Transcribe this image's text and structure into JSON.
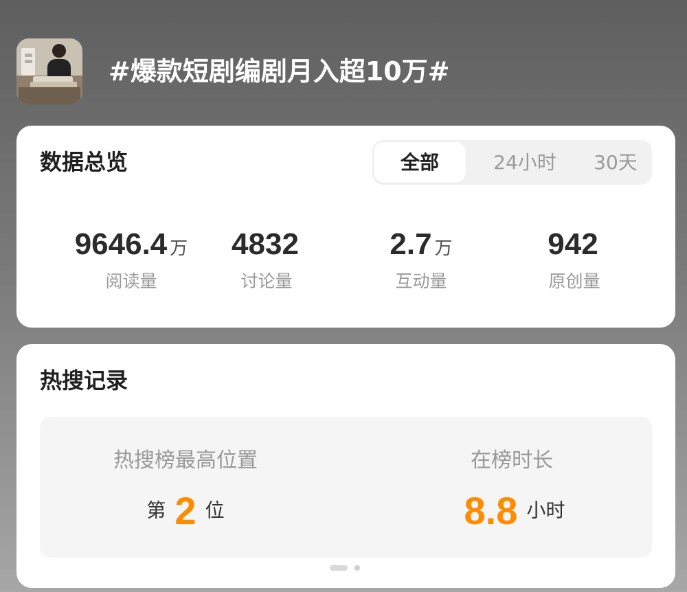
{
  "topic": {
    "title": "#爆款短剧编剧月入超10万#",
    "thumbnail_icon": "topic-thumbnail-image"
  },
  "overview": {
    "title": "数据总览",
    "tabs": [
      {
        "label": "全部",
        "selected": true
      },
      {
        "label": "24小时",
        "selected": false
      },
      {
        "label": "30天",
        "selected": false
      }
    ],
    "metrics": [
      {
        "value": "9646.4",
        "unit": "万",
        "label": "阅读量"
      },
      {
        "value": "4832",
        "unit": "",
        "label": "讨论量"
      },
      {
        "value": "2.7",
        "unit": "万",
        "label": "互动量"
      },
      {
        "value": "942",
        "unit": "",
        "label": "原创量"
      }
    ]
  },
  "hot_search": {
    "title": "热搜记录",
    "highest_rank": {
      "label": "热搜榜最高位置",
      "prefix": "第",
      "value": "2",
      "suffix": "位"
    },
    "duration": {
      "label": "在榜时长",
      "value": "8.8",
      "suffix": "小时"
    },
    "pager": {
      "current": 1,
      "total": 2
    }
  },
  "colors": {
    "accent_orange": "#ff8c00",
    "card_background": "#ffffff",
    "panel_background": "#f5f5f5"
  }
}
